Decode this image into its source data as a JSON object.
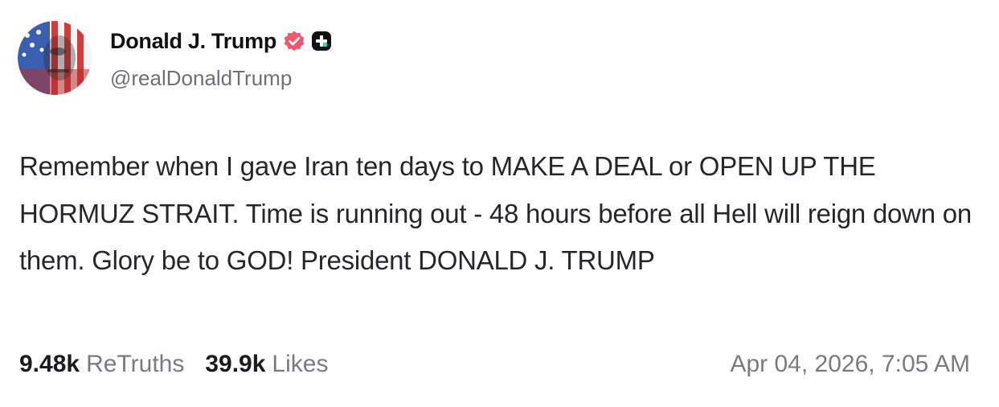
{
  "author": {
    "display_name": "Donald J. Trump",
    "handle": "@realDonaldTrump",
    "avatar_icon": "avatar-flag-portrait",
    "verified_icon": "verified-badge-icon",
    "extra_badge_icon": "plus-badge-icon"
  },
  "post": {
    "text": "Remember when I gave Iran ten days to MAKE A DEAL or OPEN UP THE HORMUZ STRAIT. Time is running out - 48 hours before all Hell will reign down on them. Glory be to GOD! President DONALD J. TRUMP"
  },
  "stats": {
    "retruths_value": "9.48k",
    "retruths_label": "ReTruths",
    "likes_value": "39.9k",
    "likes_label": "Likes"
  },
  "timestamp": "Apr 04, 2026, 7:05 AM",
  "colors": {
    "verified": "#f2566e",
    "badge": "#111114",
    "muted_text": "#7a7a82",
    "body_text": "#27272b"
  }
}
